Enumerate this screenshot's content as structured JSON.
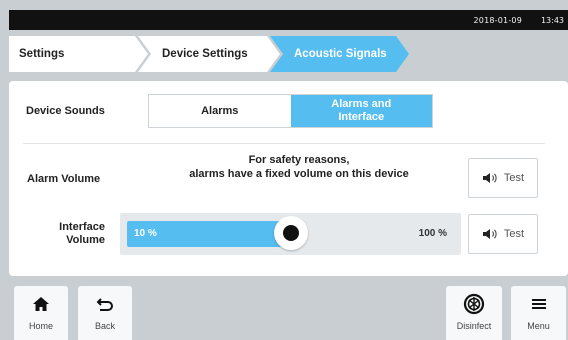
{
  "status": {
    "date": "2018-01-09",
    "time": "13:43"
  },
  "breadcrumb": [
    "Settings",
    "Device Settings",
    "Acoustic Signals"
  ],
  "device_sounds": {
    "label": "Device Sounds",
    "options": [
      "Alarms",
      "Alarms and\nInterface"
    ],
    "selected": "Alarms and Interface"
  },
  "alarm_volume": {
    "label": "Alarm Volume",
    "message_line1": "For safety reasons,",
    "message_line2": "alarms have a fixed volume on this device",
    "test_label": "Test"
  },
  "interface_volume": {
    "label_line1": "Interface",
    "label_line2": "Volume",
    "min_label": "10 %",
    "max_label": "100 %",
    "value_fraction": 0.5,
    "test_label": "Test"
  },
  "nav": {
    "home": "Home",
    "back": "Back",
    "disinfect": "Disinfect",
    "menu": "Menu"
  },
  "colors": {
    "accent": "#55bdf0",
    "background": "#c9ced2",
    "status_bar": "#111111"
  }
}
